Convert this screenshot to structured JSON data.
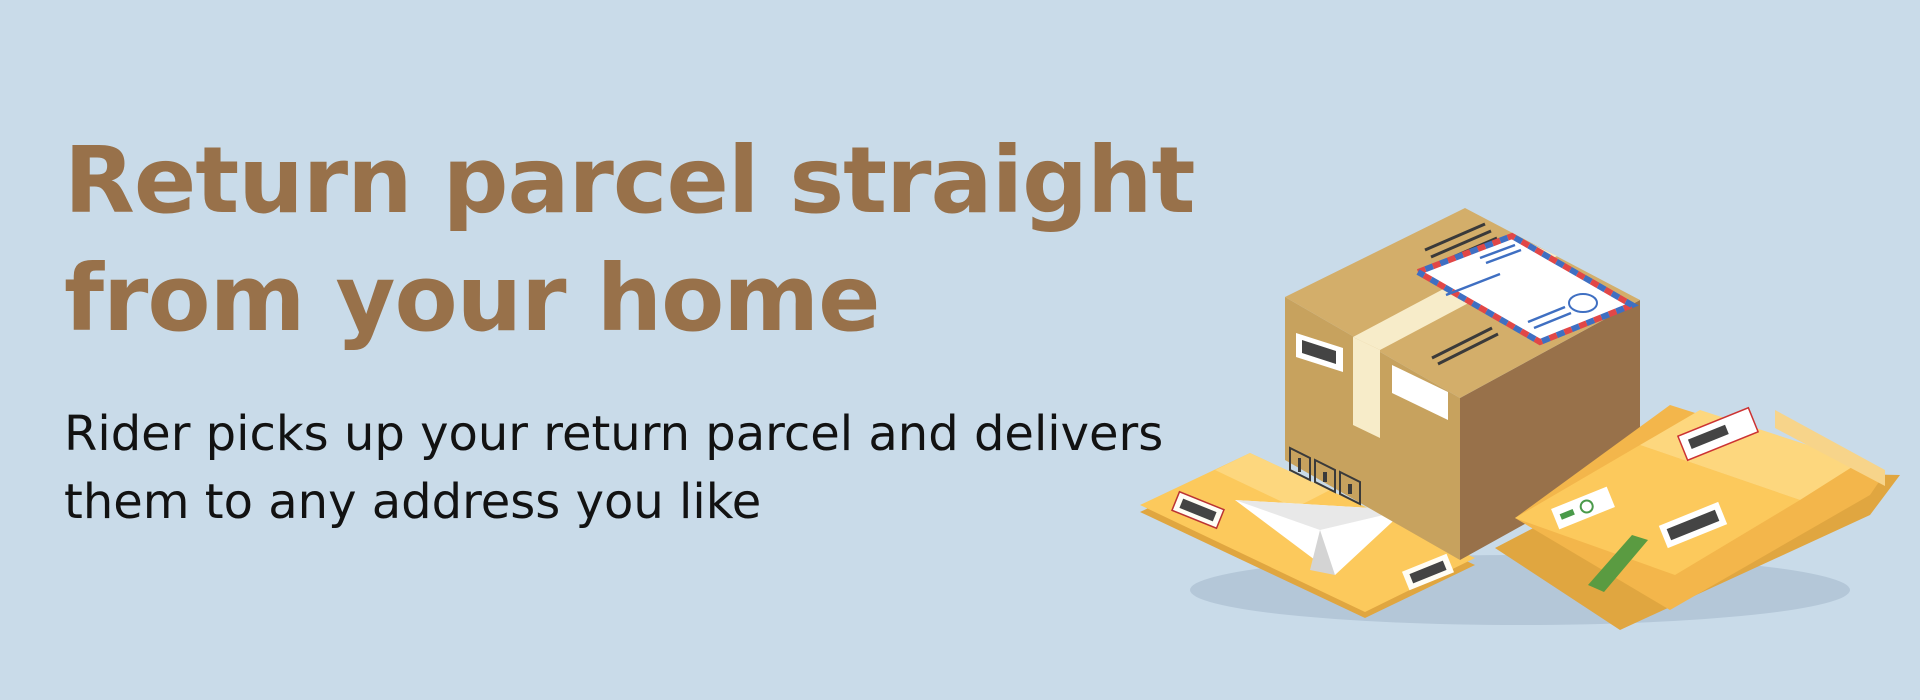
{
  "banner": {
    "headline": "Return parcel straight from your home",
    "subline": "Rider picks up your return parcel and delivers them to any address you like"
  },
  "illustration": {
    "icons": [
      "cardboard-box-icon",
      "airmail-envelope-icon",
      "flat-envelope-icon",
      "paper-airplane-icon",
      "padded-envelope-icon",
      "barcode-icon",
      "handling-symbols-icon"
    ],
    "colors": {
      "background": "#c9dbe9",
      "headline": "#98714a",
      "subline": "#121212",
      "box_light": "#c7a25e",
      "box_dark": "#98714a",
      "envelope_yellow": "#fcc95c"
    }
  }
}
